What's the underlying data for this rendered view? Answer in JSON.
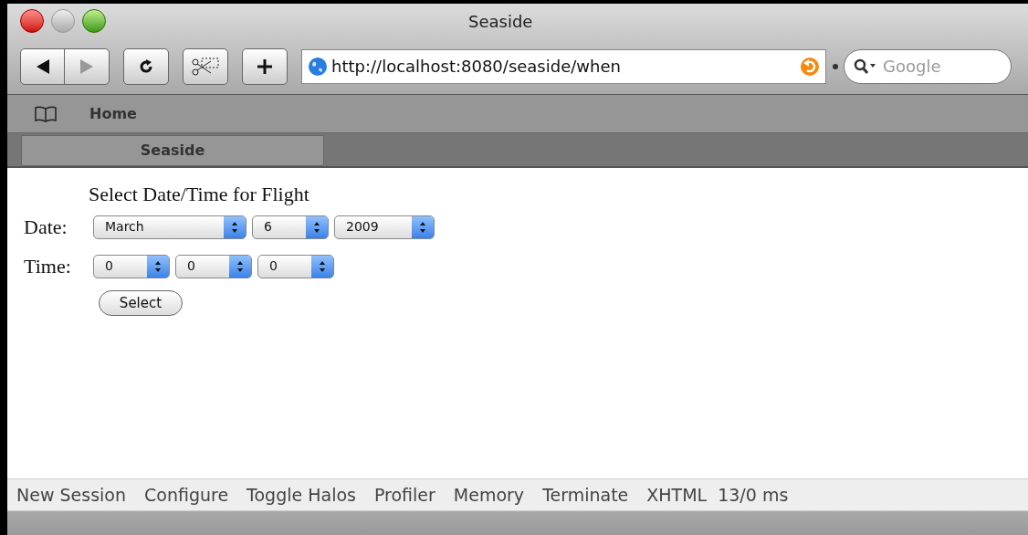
{
  "window": {
    "title": "Seaside"
  },
  "toolbar": {
    "url": "http://localhost:8080/seaside/when",
    "search_placeholder": "Google"
  },
  "bookmarks": [
    {
      "label": "Home"
    }
  ],
  "tabs": [
    {
      "label": "Seaside",
      "selected": true
    }
  ],
  "page": {
    "heading": "Select Date/Time for Flight",
    "rows": [
      {
        "label": "Date:",
        "selects": [
          {
            "value": "March"
          },
          {
            "value": "6"
          },
          {
            "value": "2009"
          }
        ]
      },
      {
        "label": "Time:",
        "selects": [
          {
            "value": "0"
          },
          {
            "value": "0"
          },
          {
            "value": "0"
          }
        ]
      }
    ],
    "button": "Select"
  },
  "footer_links": [
    "New Session",
    "Configure",
    "Toggle Halos",
    "Profiler",
    "Memory",
    "Terminate",
    "XHTML"
  ],
  "footer_timing": "13/0 ms"
}
